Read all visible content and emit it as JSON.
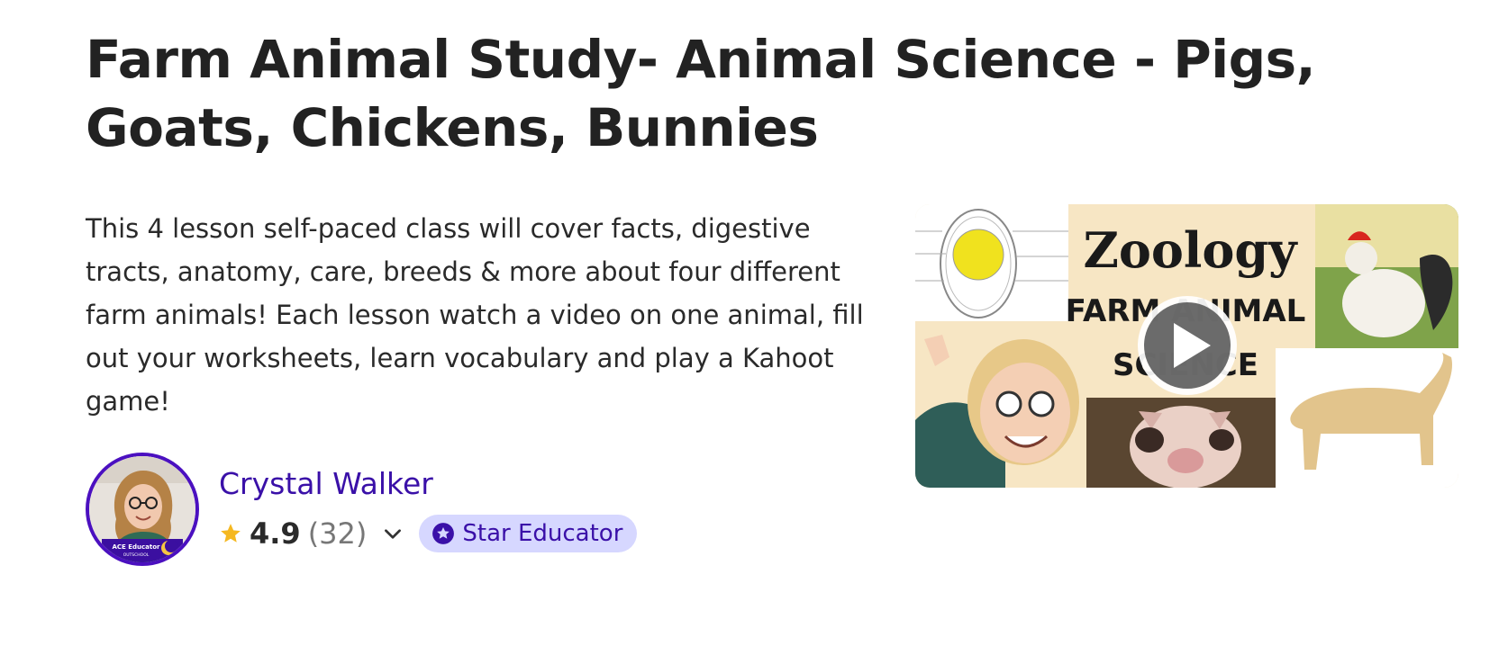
{
  "class": {
    "title": "Farm Animal Study- Animal Science - Pigs, Goats, Chickens, Bunnies",
    "description": "This 4 lesson self-paced class will cover facts, digestive tracts, anatomy, care, breeds & more about four different farm animals! Each lesson watch a video on one animal, fill out your worksheets, learn vocabulary and play a Kahoot game!"
  },
  "teacher": {
    "name": "Crystal Walker",
    "rating": "4.9",
    "review_count": "(32)",
    "badge": "Star Educator",
    "avatar_badge_text": "ACE Educator",
    "avatar_badge_subtext": "OUTSCHOOL"
  },
  "video": {
    "thumbnail_title_1": "Zoology",
    "thumbnail_title_2a": "FARM ANIMAL",
    "thumbnail_title_2b": "SCIENCE"
  },
  "icons": {
    "star": "star-icon",
    "chevron": "chevron-down-icon",
    "badge": "star-badge-icon",
    "play": "play-icon"
  },
  "colors": {
    "accent": "#3a10a8",
    "avatar_ring": "#4b10c0",
    "star": "#f5b821",
    "badge_bg": "#d6d7ff"
  }
}
